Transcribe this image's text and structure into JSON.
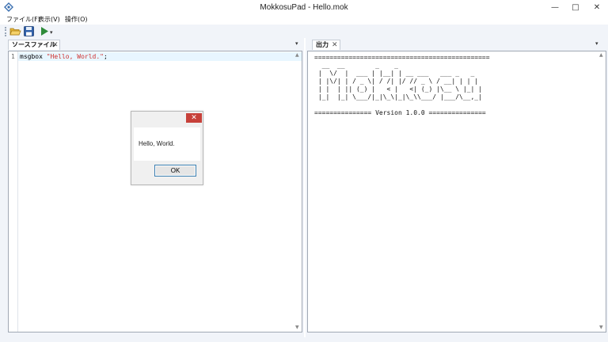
{
  "window": {
    "title": "MokkosuPad - Hello.mok",
    "minimize_glyph": "—",
    "maximize_glyph": "□",
    "close_glyph": "✕",
    "icon": "diamond-app-icon"
  },
  "menu": {
    "items": [
      "ファイル(F)",
      "表示(V)",
      "操作(O)"
    ]
  },
  "toolbar": {
    "buttons": [
      {
        "name": "open-folder",
        "icon": "folder-icon"
      },
      {
        "name": "save",
        "icon": "floppy-icon"
      },
      {
        "name": "run",
        "icon": "play-icon"
      }
    ],
    "dropdown_glyph": "▾"
  },
  "source_pane": {
    "tab_label": "ソースファイル",
    "tab_close": "✕",
    "pane_menu_glyph": "▾",
    "lines": [
      {
        "number": "1",
        "keyword": "msgbox ",
        "string": "\"Hello, World.\"",
        "tail": ";"
      }
    ]
  },
  "output_pane": {
    "tab_label": "出力",
    "tab_close": "✕",
    "pane_menu_glyph": "▾",
    "text": "==============================================\n  __  __        _    _\n |  \\/  |  ___ | |__| | __ ___   ___ _   _\n | |\\/| | / _ \\| / /| |/ // _ \\ / __| | | |\n | |  | || (_) |   < |   <| (_) |\\__ \\ |_| |\n |_|  |_| \\___/|_|\\_\\|_|\\_\\\\___/ |___/\\__,_|\n\n=============== Version 1.0.0 ==============="
  },
  "dialog": {
    "close_glyph": "✕",
    "message": "Hello, World.",
    "ok_label": "OK"
  },
  "colors": {
    "accent": "#2e7d32",
    "close_red": "#c7413a",
    "string_red": "#d0312d"
  }
}
